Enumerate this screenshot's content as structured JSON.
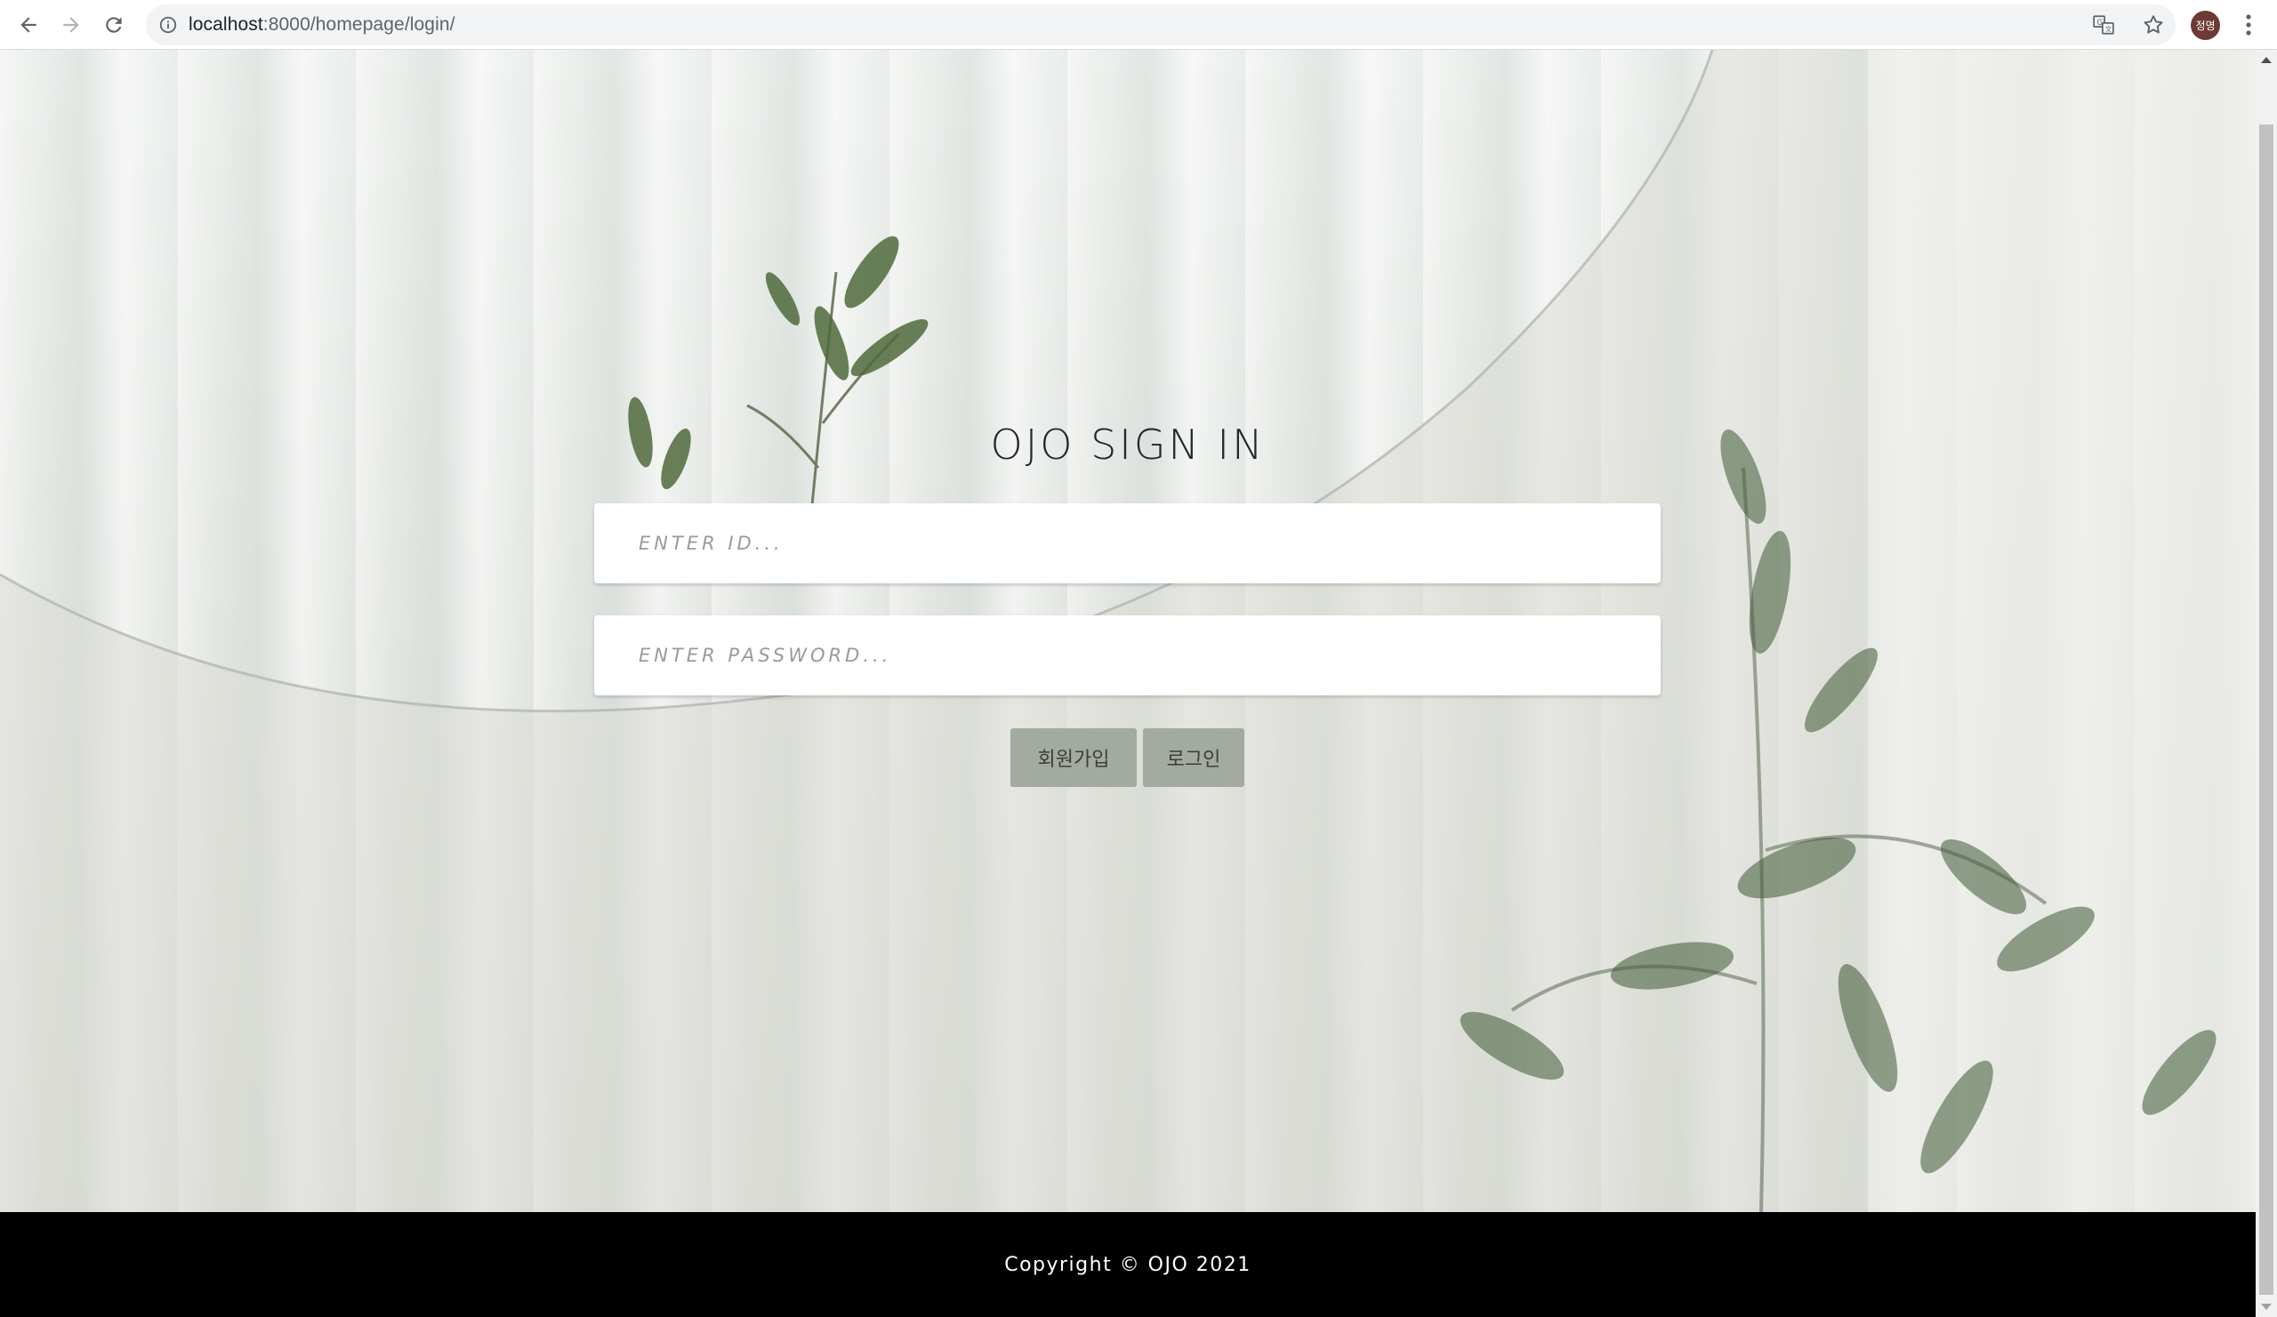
{
  "browser": {
    "url_host": "localhost",
    "url_rest": ":8000/homepage/login/",
    "profile_initials": "정명"
  },
  "login": {
    "title": "OJO SIGN IN",
    "id_placeholder": "ENTER ID...",
    "password_placeholder": "ENTER PASSWORD...",
    "signup_label": "회원가입",
    "login_label": "로그인"
  },
  "footer": {
    "copyright": "Copyright © OJO 2021"
  },
  "colors": {
    "button_bg": "#a3aaa0",
    "footer_bg": "#000000",
    "title_color": "#22282a"
  }
}
